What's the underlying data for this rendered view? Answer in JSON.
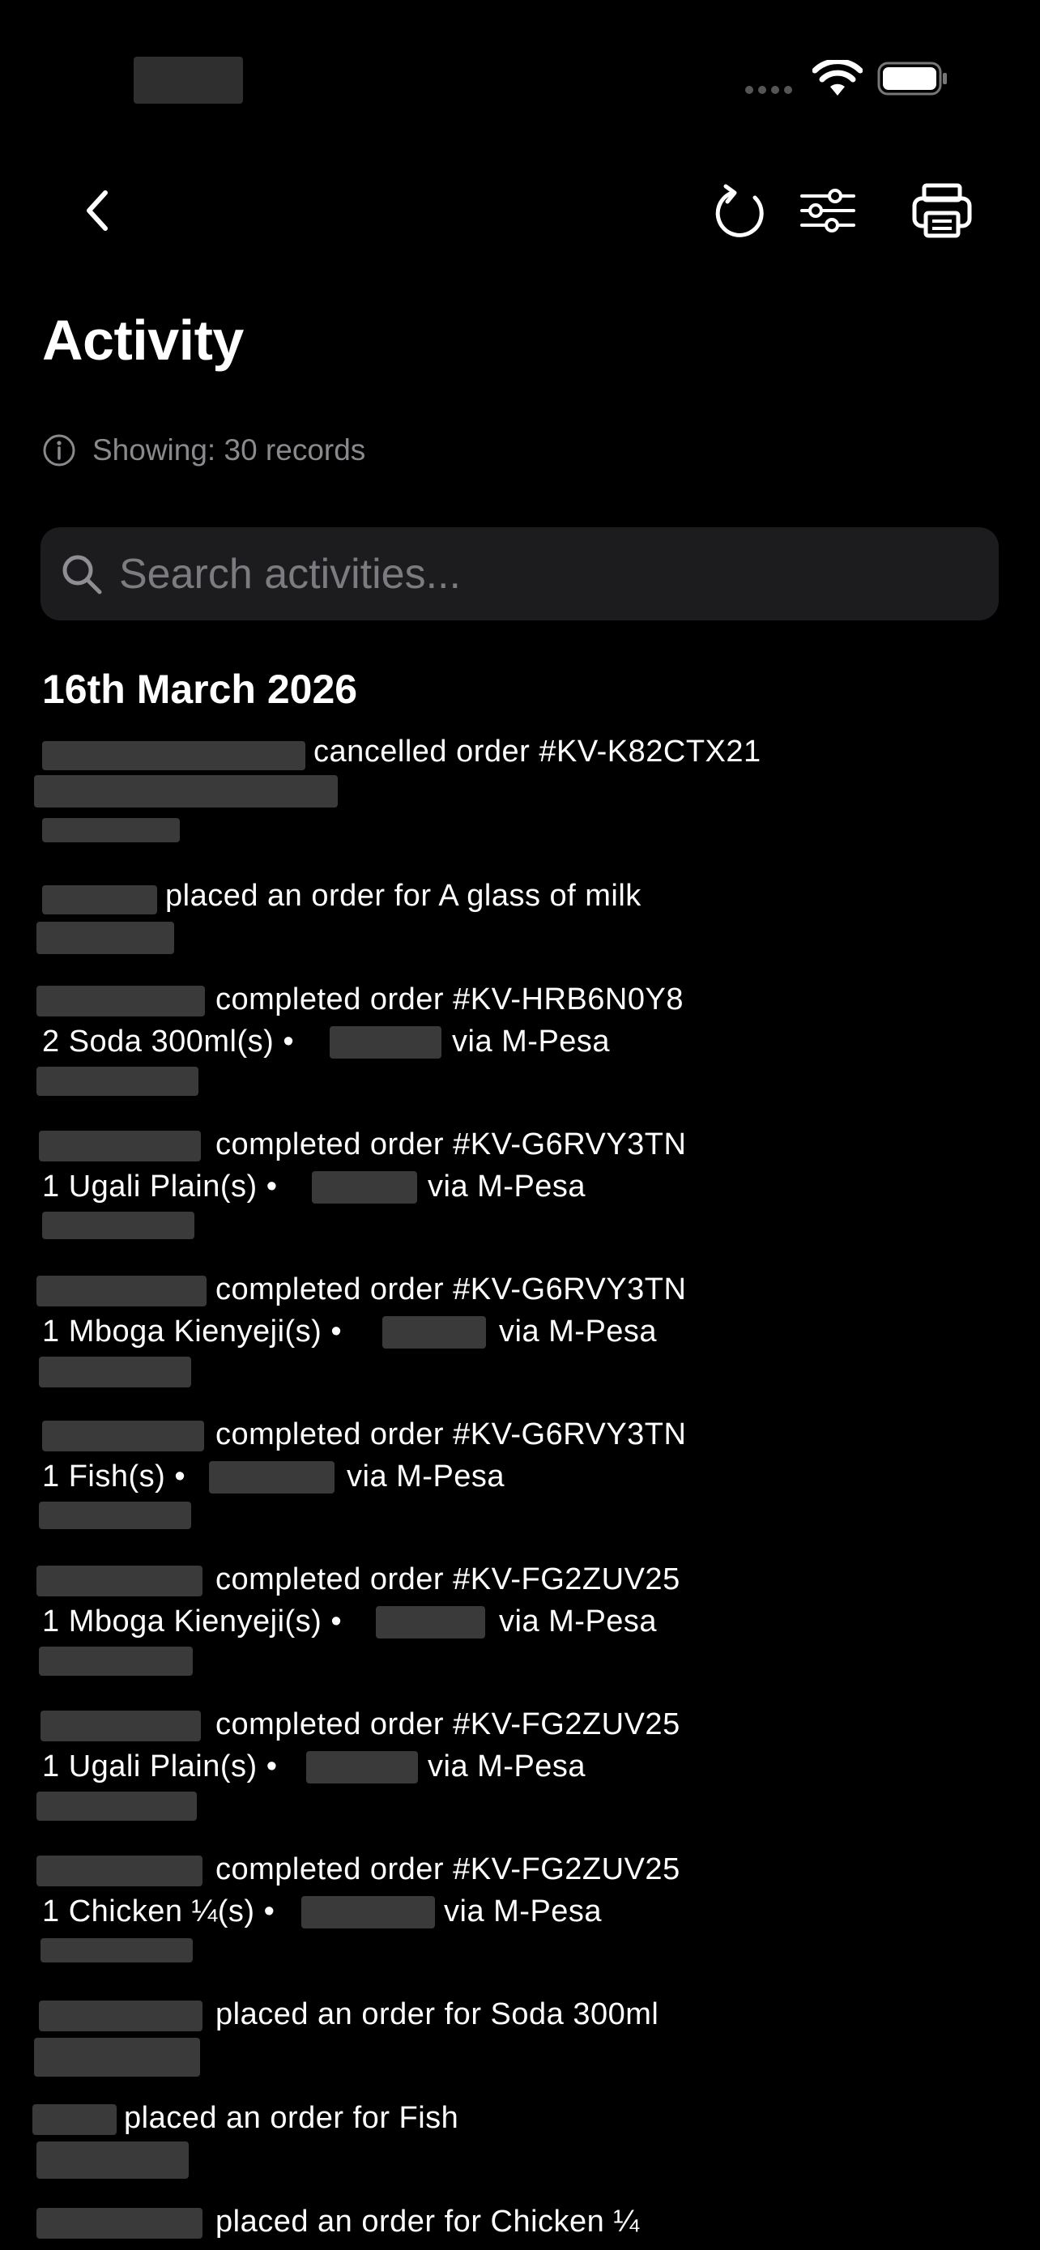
{
  "screen": {
    "title": "Activity",
    "records_info": "Showing: 30 records",
    "search_placeholder": "Search activities...",
    "date_header": "16th March 2026",
    "toolbar": {
      "back": "back-icon",
      "refresh": "refresh-icon",
      "filter": "filter-sliders-icon",
      "print": "print-icon"
    }
  },
  "activities": [
    {
      "action": "cancelled order #KV-K82CTX21"
    },
    {
      "action": "placed an order for A glass of milk"
    },
    {
      "action": "completed order #KV-HRB6N0Y8",
      "detail_items": "2 Soda 300ml(s) •",
      "detail_method": "via M-Pesa"
    },
    {
      "action": "completed order #KV-G6RVY3TN",
      "detail_items": "1 Ugali Plain(s) •",
      "detail_method": "via M-Pesa"
    },
    {
      "action": "completed order #KV-G6RVY3TN",
      "detail_items": "1 Mboga Kienyeji(s) •",
      "detail_method": "via M-Pesa"
    },
    {
      "action": "completed order #KV-G6RVY3TN",
      "detail_items": "1 Fish(s) •",
      "detail_method": "via M-Pesa"
    },
    {
      "action": "completed order #KV-FG2ZUV25",
      "detail_items": "1 Mboga Kienyeji(s) •",
      "detail_method": "via M-Pesa"
    },
    {
      "action": "completed order #KV-FG2ZUV25",
      "detail_items": "1 Ugali Plain(s) •",
      "detail_method": "via M-Pesa"
    },
    {
      "action": "completed order #KV-FG2ZUV25",
      "detail_items": "1 Chicken ¼(s) •",
      "detail_method": "via M-Pesa"
    },
    {
      "action": "placed an order for Soda 300ml"
    },
    {
      "action": "placed an order for Fish"
    },
    {
      "action": "placed an order for Chicken ¼"
    }
  ]
}
